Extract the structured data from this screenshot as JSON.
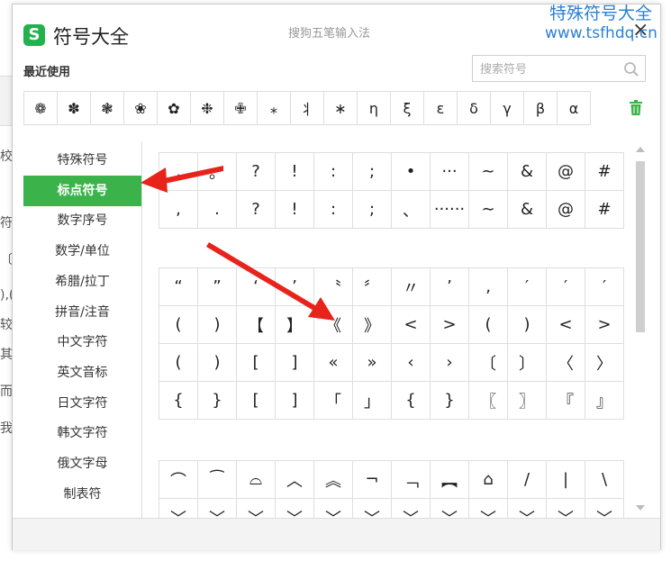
{
  "dialog": {
    "logo_letter": "S",
    "title": "符号大全",
    "subtitle": "搜狗五笔输入法",
    "close_glyph": "×"
  },
  "watermark": {
    "line1": "特殊符号大全",
    "line2": "www.tsfhdq.cn"
  },
  "background_fragments": [
    "校",
    "符",
    "〔",
    "),(",
    "较",
    "其",
    "而",
    "我"
  ],
  "recent": {
    "label": "最近使用",
    "symbols": [
      "❁",
      "✽",
      "❃",
      "❀",
      "✿",
      "❉",
      "✙",
      "⁎",
      "⺦",
      "∗",
      "η",
      "ξ",
      "ε",
      "δ",
      "γ",
      "β",
      "α"
    ]
  },
  "search": {
    "placeholder": "搜索符号"
  },
  "categories": [
    {
      "label": "特殊符号",
      "active": false
    },
    {
      "label": "标点符号",
      "active": true
    },
    {
      "label": "数字序号",
      "active": false
    },
    {
      "label": "数学/单位",
      "active": false
    },
    {
      "label": "希腊/拉丁",
      "active": false
    },
    {
      "label": "拼音/注音",
      "active": false
    },
    {
      "label": "中文字符",
      "active": false
    },
    {
      "label": "英文音标",
      "active": false
    },
    {
      "label": "日文字符",
      "active": false
    },
    {
      "label": "韩文字符",
      "active": false
    },
    {
      "label": "俄文字母",
      "active": false
    },
    {
      "label": "制表符",
      "active": false
    }
  ],
  "symbol_groups": [
    {
      "rows": [
        [
          ",",
          "。",
          "?",
          "!",
          ":",
          ";",
          "•",
          "···",
          "~",
          "&",
          "@",
          "#"
        ],
        [
          ",",
          ".",
          "?",
          "!",
          ":",
          ";",
          "、",
          "······",
          "∼",
          "&",
          "@",
          "#"
        ]
      ]
    },
    {
      "rows": [
        [
          "“",
          "”",
          "‘",
          "’",
          "〝",
          "〞",
          "〃",
          "’",
          "‚",
          "′",
          "′",
          "′"
        ],
        [
          "(",
          ")",
          "【",
          "】",
          "《",
          "》",
          "<",
          ">",
          "(",
          ")",
          "<",
          ">"
        ],
        [
          "(",
          ")",
          "[",
          "]",
          "«",
          "»",
          "‹",
          "›",
          "〔",
          "〕",
          "〈",
          "〉"
        ],
        [
          "{",
          "}",
          "[",
          "]",
          "「",
          "」",
          "{",
          "}",
          "〖",
          "〗",
          "『",
          "』"
        ]
      ]
    },
    {
      "rows": [
        [
          "⌒",
          "⁀",
          "⌓",
          "︿",
          "︽",
          "¬",
          "﹁",
          "︻",
          "⌂",
          "/",
          "|",
          "\\"
        ],
        [
          "﹀",
          "﹀",
          "﹀",
          "﹀",
          "﹀",
          "﹀",
          "﹀",
          "﹀",
          "﹀",
          "﹀",
          "﹀",
          "﹀"
        ]
      ]
    }
  ],
  "colors": {
    "accent": "#3cb34a",
    "arrow": "#e8231c",
    "watermark": "#2a7fd4"
  }
}
